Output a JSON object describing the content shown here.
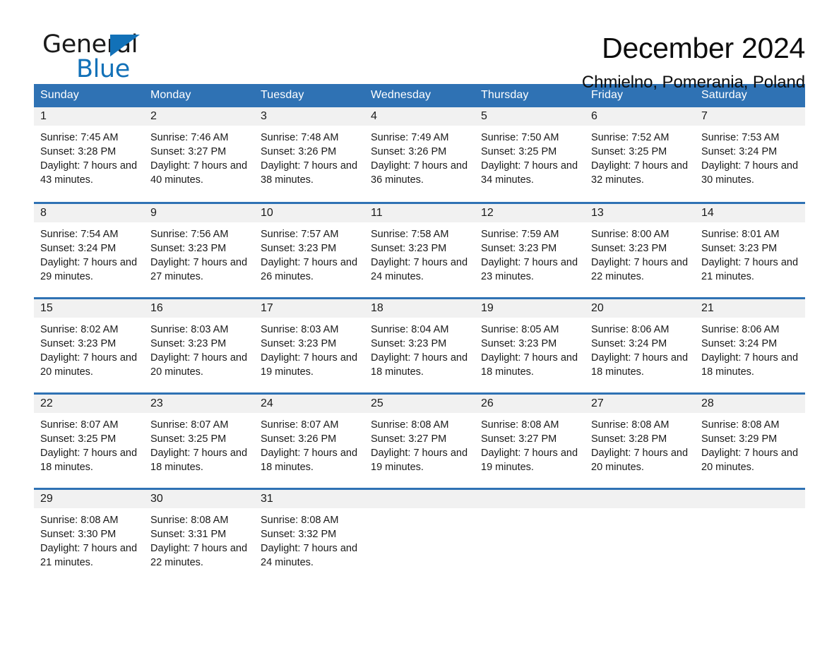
{
  "brand": {
    "word_one": "General",
    "word_two": "Blue",
    "triangle_icon": "triangle-icon"
  },
  "header": {
    "title": "December 2024",
    "subtitle": "Chmielno, Pomerania, Poland"
  },
  "colors": {
    "header_blue": "#2f72b4",
    "brand_blue": "#1271b8",
    "daynum_bg": "#f1f1f1",
    "text": "#1a1a1a"
  },
  "weekday_headers": [
    "Sunday",
    "Monday",
    "Tuesday",
    "Wednesday",
    "Thursday",
    "Friday",
    "Saturday"
  ],
  "weeks": [
    [
      {
        "day": "1",
        "sunrise": "Sunrise: 7:45 AM",
        "sunset": "Sunset: 3:28 PM",
        "daylight": "Daylight: 7 hours and 43 minutes."
      },
      {
        "day": "2",
        "sunrise": "Sunrise: 7:46 AM",
        "sunset": "Sunset: 3:27 PM",
        "daylight": "Daylight: 7 hours and 40 minutes."
      },
      {
        "day": "3",
        "sunrise": "Sunrise: 7:48 AM",
        "sunset": "Sunset: 3:26 PM",
        "daylight": "Daylight: 7 hours and 38 minutes."
      },
      {
        "day": "4",
        "sunrise": "Sunrise: 7:49 AM",
        "sunset": "Sunset: 3:26 PM",
        "daylight": "Daylight: 7 hours and 36 minutes."
      },
      {
        "day": "5",
        "sunrise": "Sunrise: 7:50 AM",
        "sunset": "Sunset: 3:25 PM",
        "daylight": "Daylight: 7 hours and 34 minutes."
      },
      {
        "day": "6",
        "sunrise": "Sunrise: 7:52 AM",
        "sunset": "Sunset: 3:25 PM",
        "daylight": "Daylight: 7 hours and 32 minutes."
      },
      {
        "day": "7",
        "sunrise": "Sunrise: 7:53 AM",
        "sunset": "Sunset: 3:24 PM",
        "daylight": "Daylight: 7 hours and 30 minutes."
      }
    ],
    [
      {
        "day": "8",
        "sunrise": "Sunrise: 7:54 AM",
        "sunset": "Sunset: 3:24 PM",
        "daylight": "Daylight: 7 hours and 29 minutes."
      },
      {
        "day": "9",
        "sunrise": "Sunrise: 7:56 AM",
        "sunset": "Sunset: 3:23 PM",
        "daylight": "Daylight: 7 hours and 27 minutes."
      },
      {
        "day": "10",
        "sunrise": "Sunrise: 7:57 AM",
        "sunset": "Sunset: 3:23 PM",
        "daylight": "Daylight: 7 hours and 26 minutes."
      },
      {
        "day": "11",
        "sunrise": "Sunrise: 7:58 AM",
        "sunset": "Sunset: 3:23 PM",
        "daylight": "Daylight: 7 hours and 24 minutes."
      },
      {
        "day": "12",
        "sunrise": "Sunrise: 7:59 AM",
        "sunset": "Sunset: 3:23 PM",
        "daylight": "Daylight: 7 hours and 23 minutes."
      },
      {
        "day": "13",
        "sunrise": "Sunrise: 8:00 AM",
        "sunset": "Sunset: 3:23 PM",
        "daylight": "Daylight: 7 hours and 22 minutes."
      },
      {
        "day": "14",
        "sunrise": "Sunrise: 8:01 AM",
        "sunset": "Sunset: 3:23 PM",
        "daylight": "Daylight: 7 hours and 21 minutes."
      }
    ],
    [
      {
        "day": "15",
        "sunrise": "Sunrise: 8:02 AM",
        "sunset": "Sunset: 3:23 PM",
        "daylight": "Daylight: 7 hours and 20 minutes."
      },
      {
        "day": "16",
        "sunrise": "Sunrise: 8:03 AM",
        "sunset": "Sunset: 3:23 PM",
        "daylight": "Daylight: 7 hours and 20 minutes."
      },
      {
        "day": "17",
        "sunrise": "Sunrise: 8:03 AM",
        "sunset": "Sunset: 3:23 PM",
        "daylight": "Daylight: 7 hours and 19 minutes."
      },
      {
        "day": "18",
        "sunrise": "Sunrise: 8:04 AM",
        "sunset": "Sunset: 3:23 PM",
        "daylight": "Daylight: 7 hours and 18 minutes."
      },
      {
        "day": "19",
        "sunrise": "Sunrise: 8:05 AM",
        "sunset": "Sunset: 3:23 PM",
        "daylight": "Daylight: 7 hours and 18 minutes."
      },
      {
        "day": "20",
        "sunrise": "Sunrise: 8:06 AM",
        "sunset": "Sunset: 3:24 PM",
        "daylight": "Daylight: 7 hours and 18 minutes."
      },
      {
        "day": "21",
        "sunrise": "Sunrise: 8:06 AM",
        "sunset": "Sunset: 3:24 PM",
        "daylight": "Daylight: 7 hours and 18 minutes."
      }
    ],
    [
      {
        "day": "22",
        "sunrise": "Sunrise: 8:07 AM",
        "sunset": "Sunset: 3:25 PM",
        "daylight": "Daylight: 7 hours and 18 minutes."
      },
      {
        "day": "23",
        "sunrise": "Sunrise: 8:07 AM",
        "sunset": "Sunset: 3:25 PM",
        "daylight": "Daylight: 7 hours and 18 minutes."
      },
      {
        "day": "24",
        "sunrise": "Sunrise: 8:07 AM",
        "sunset": "Sunset: 3:26 PM",
        "daylight": "Daylight: 7 hours and 18 minutes."
      },
      {
        "day": "25",
        "sunrise": "Sunrise: 8:08 AM",
        "sunset": "Sunset: 3:27 PM",
        "daylight": "Daylight: 7 hours and 19 minutes."
      },
      {
        "day": "26",
        "sunrise": "Sunrise: 8:08 AM",
        "sunset": "Sunset: 3:27 PM",
        "daylight": "Daylight: 7 hours and 19 minutes."
      },
      {
        "day": "27",
        "sunrise": "Sunrise: 8:08 AM",
        "sunset": "Sunset: 3:28 PM",
        "daylight": "Daylight: 7 hours and 20 minutes."
      },
      {
        "day": "28",
        "sunrise": "Sunrise: 8:08 AM",
        "sunset": "Sunset: 3:29 PM",
        "daylight": "Daylight: 7 hours and 20 minutes."
      }
    ],
    [
      {
        "day": "29",
        "sunrise": "Sunrise: 8:08 AM",
        "sunset": "Sunset: 3:30 PM",
        "daylight": "Daylight: 7 hours and 21 minutes."
      },
      {
        "day": "30",
        "sunrise": "Sunrise: 8:08 AM",
        "sunset": "Sunset: 3:31 PM",
        "daylight": "Daylight: 7 hours and 22 minutes."
      },
      {
        "day": "31",
        "sunrise": "Sunrise: 8:08 AM",
        "sunset": "Sunset: 3:32 PM",
        "daylight": "Daylight: 7 hours and 24 minutes."
      },
      {
        "day": "",
        "sunrise": "",
        "sunset": "",
        "daylight": ""
      },
      {
        "day": "",
        "sunrise": "",
        "sunset": "",
        "daylight": ""
      },
      {
        "day": "",
        "sunrise": "",
        "sunset": "",
        "daylight": ""
      },
      {
        "day": "",
        "sunrise": "",
        "sunset": "",
        "daylight": ""
      }
    ]
  ]
}
